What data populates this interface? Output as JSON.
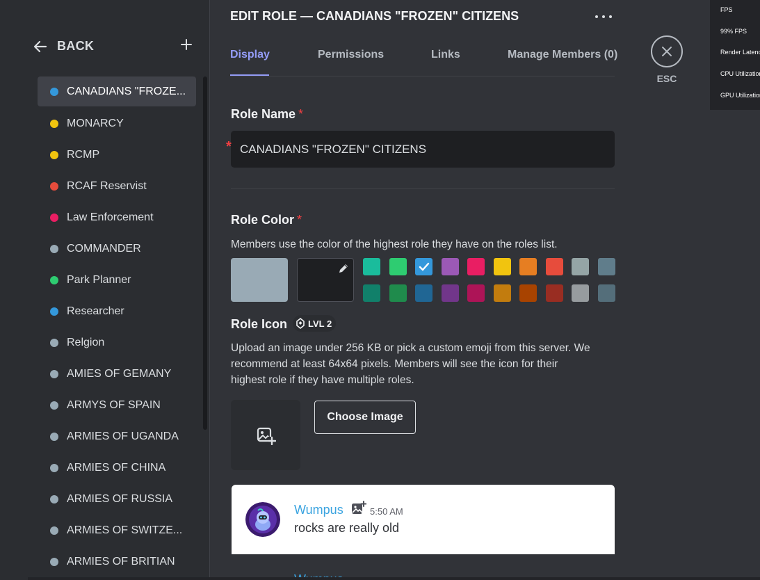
{
  "sidebar": {
    "back_label": "BACK",
    "add_role_icon": "plus-icon",
    "roles": [
      {
        "name": "CANADIANS \"FROZEN\" CITIZENS",
        "display": "CANADIANS \"FROZE...",
        "color": "#3498db",
        "active": true
      },
      {
        "name": "MONARCY",
        "display": "MONARCY",
        "color": "#f1c40f"
      },
      {
        "name": "RCMP",
        "display": "RCMP",
        "color": "#f1c40f"
      },
      {
        "name": "RCAF Reservist",
        "display": "RCAF Reservist",
        "color": "#e74c3c"
      },
      {
        "name": "Law Enforcement",
        "display": "Law Enforcement",
        "color": "#e91e63"
      },
      {
        "name": "COMMANDER",
        "display": "COMMANDER",
        "color": "#99aab5"
      },
      {
        "name": "Park Planner",
        "display": "Park Planner",
        "color": "#2ecc71"
      },
      {
        "name": "Researcher",
        "display": "Researcher",
        "color": "#3498db"
      },
      {
        "name": "Relgion",
        "display": "Relgion",
        "color": "#99aab5"
      },
      {
        "name": "AMIES OF GEMANY",
        "display": "AMIES OF GEMANY",
        "color": "#99aab5"
      },
      {
        "name": "ARMYS OF SPAIN",
        "display": "ARMYS OF SPAIN",
        "color": "#99aab5"
      },
      {
        "name": "ARMIES OF UGANDA",
        "display": "ARMIES OF UGANDA",
        "color": "#99aab5"
      },
      {
        "name": "ARMIES OF CHINA",
        "display": "ARMIES OF CHINA",
        "color": "#99aab5"
      },
      {
        "name": "ARMIES OF RUSSIA",
        "display": "ARMIES OF RUSSIA",
        "color": "#99aab5"
      },
      {
        "name": "ARMIES OF SWITZERLAND",
        "display": "ARMIES OF SWITZE...",
        "color": "#99aab5"
      },
      {
        "name": "ARMIES OF BRITIAN",
        "display": "ARMIES OF BRITIAN",
        "color": "#99aab5"
      }
    ]
  },
  "header": {
    "title": "EDIT ROLE — CANADIANS \"FROZEN\" CITIZENS",
    "more_icon": "more-horizontal-icon"
  },
  "tabs": [
    {
      "label": "Display",
      "active": true
    },
    {
      "label": "Permissions",
      "active": false
    },
    {
      "label": "Links",
      "active": false
    },
    {
      "label": "Manage Members (0)",
      "active": false
    }
  ],
  "role_name": {
    "label": "Role Name",
    "required_mark": "*",
    "value": "CANADIANS \"FROZEN\" CITIZENS"
  },
  "role_color": {
    "label": "Role Color",
    "required_mark": "*",
    "description": "Members use the color of the highest role they have on the roles list.",
    "default_color": "#99aab5",
    "selected_color": "#3498db",
    "palette_top": [
      "#1abc9c",
      "#2ecc71",
      "#3498db",
      "#9b59b6",
      "#e91e63",
      "#f1c40f",
      "#e67e22",
      "#e74c3c",
      "#95a5a6",
      "#607d8b"
    ],
    "palette_bottom": [
      "#11806a",
      "#1f8b4c",
      "#206694",
      "#71368a",
      "#ad1457",
      "#c27c0e",
      "#a84300",
      "#992d22",
      "#979c9f",
      "#546e7a"
    ]
  },
  "role_icon": {
    "label": "Role Icon",
    "badge": "LVL 2",
    "description_lines": [
      "Upload an image under 256 KB or pick a custom emoji from this server. We",
      "recommend at least 64x64 pixels. Members will see the icon for their",
      "highest role if they have multiple roles."
    ],
    "choose_label": "Choose Image",
    "upload_icon": "image-add-icon"
  },
  "preview": {
    "username": "Wumpus",
    "time": "5:50 AM",
    "message": "rocks are really old"
  },
  "close": {
    "label": "ESC",
    "icon": "close-icon"
  },
  "overlay": {
    "rows": [
      "FPS",
      "99% FPS",
      "Render Latency",
      "CPU Utilization",
      "GPU Utilization"
    ]
  }
}
